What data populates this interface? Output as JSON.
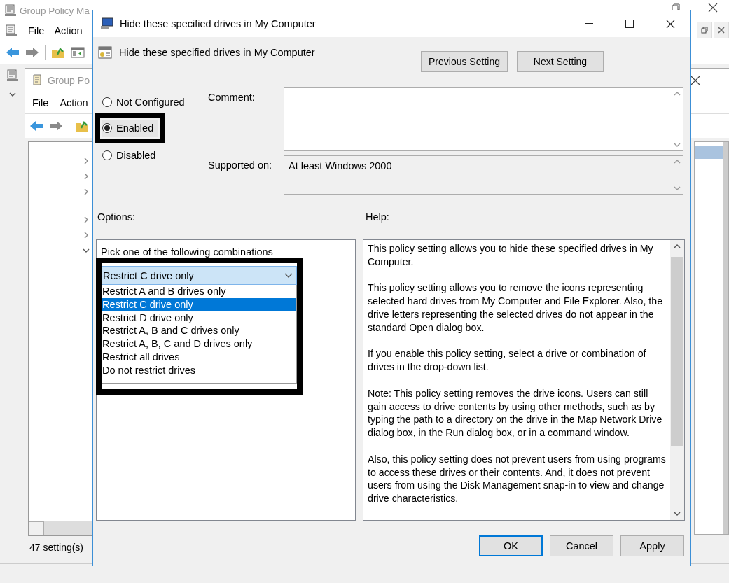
{
  "main_window": {
    "title": "Group Policy Ma",
    "menu": [
      "File",
      "Action"
    ]
  },
  "inner_window": {
    "title": "Group Po",
    "menu": [
      "File",
      "Action"
    ],
    "tree_nodes": [
      {
        "expanded": false
      },
      {
        "expanded": false
      },
      {
        "expanded": false
      },
      {
        "expanded": false
      },
      {
        "expanded": false
      },
      {
        "expanded": true
      }
    ],
    "status": "47 setting(s)"
  },
  "dialog": {
    "title": "Hide these specified drives in My Computer",
    "heading": "Hide these specified drives in My Computer",
    "nav_buttons": [
      "Previous Setting",
      "Next Setting"
    ],
    "state_options": [
      {
        "label": "Not Configured",
        "selected": false
      },
      {
        "label": "Enabled",
        "selected": true
      },
      {
        "label": "Disabled",
        "selected": false
      }
    ],
    "comment_label": "Comment:",
    "supported_label": "Supported on:",
    "supported_value": "At least Windows 2000",
    "options_label": "Options:",
    "help_label": "Help:",
    "options": {
      "prompt": "Pick one of the following combinations",
      "dropdown": {
        "value": "Restrict C drive only",
        "expanded": true,
        "items": [
          {
            "label": "Restrict A and B drives only",
            "selected": false
          },
          {
            "label": "Restrict C drive only",
            "selected": true
          },
          {
            "label": "Restrict D drive only",
            "selected": false
          },
          {
            "label": "Restrict A, B and C drives only",
            "selected": false
          },
          {
            "label": "Restrict A, B, C and D drives only",
            "selected": false
          },
          {
            "label": "Restrict all drives",
            "selected": false
          },
          {
            "label": "Do not restrict drives",
            "selected": false
          }
        ]
      }
    },
    "help_paragraphs": [
      "This policy setting allows you to hide these specified drives in My Computer.",
      "This policy setting allows you to remove the icons representing selected hard drives from My Computer and File Explorer. Also, the drive letters representing the selected drives do not appear in the standard Open dialog box.",
      "If you enable this policy setting, select a drive or combination of drives in the drop-down list.",
      "Note: This policy setting removes the drive icons. Users can still gain access to drive contents by using other methods, such as by typing the path to a directory on the drive in the Map Network Drive dialog box, in the Run dialog box, or in a command window.",
      "Also, this policy setting does not prevent users from using programs to access these drives or their contents. And, it does not prevent users from using the Disk Management snap-in to view and change drive characteristics."
    ],
    "buttons": [
      {
        "label": "OK",
        "default": true
      },
      {
        "label": "Cancel",
        "default": false
      },
      {
        "label": "Apply",
        "default": false
      }
    ]
  }
}
